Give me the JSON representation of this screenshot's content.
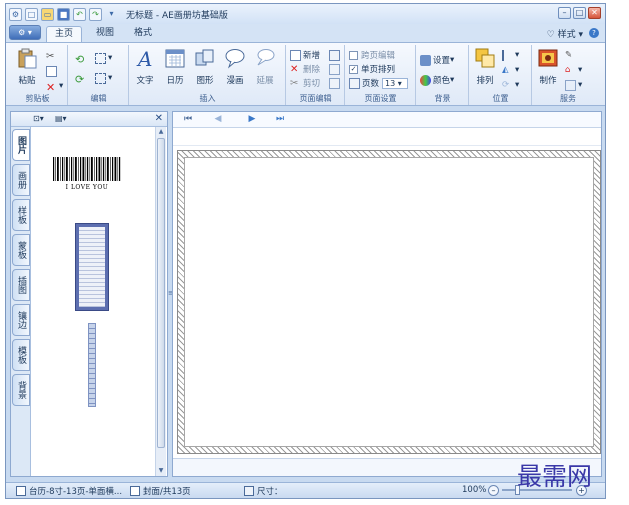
{
  "window": {
    "title": "无标题 - AE画册坊基础版",
    "controls": [
      "minimize",
      "maximize",
      "close"
    ]
  },
  "quick_access": [
    "app-icon",
    "new-icon",
    "open-icon",
    "save-icon",
    "undo-icon",
    "redo-icon",
    "dropdown-icon"
  ],
  "tabs": [
    {
      "label": "主页",
      "active": true
    },
    {
      "label": "视图",
      "active": false
    },
    {
      "label": "格式",
      "active": false
    }
  ],
  "style_menu": "样式",
  "ribbon": {
    "groups": {
      "clipboard": {
        "label": "剪贴板",
        "paste": "粘贴"
      },
      "edit": {
        "label": "编辑"
      },
      "insert": {
        "label": "插入",
        "items": [
          "文字",
          "日历",
          "图形",
          "漫画",
          "延展"
        ]
      },
      "page_edit": {
        "label": "页面编辑",
        "new": "新增",
        "delete": "删除",
        "cut": "剪切"
      },
      "page_setup": {
        "label": "页面设置",
        "cross_page": "跨页编辑",
        "single_page": "单页排列",
        "pages_label": "页数",
        "pages_value": "13"
      },
      "background": {
        "label": "背景",
        "settings": "设置",
        "color": "颜色"
      },
      "position": {
        "label": "位置",
        "arrange": "排列"
      },
      "service": {
        "label": "服务",
        "make": "制作"
      }
    }
  },
  "left_panel": {
    "vtabs": [
      "图片",
      "画册",
      "样板",
      "蒙板",
      "插图",
      "镶边",
      "模板",
      "背景"
    ],
    "barcode_text": "I LOVE YOU"
  },
  "status": {
    "template": "台历-8寸-13页-单面横...",
    "page": "封面/共13页",
    "size_label": "尺寸：",
    "zoom": "100%",
    "zoom_fraction": 0.2
  },
  "watermark": "最需网",
  "colors": {
    "accent": "#3a78c8",
    "watermark": "#3a38a8"
  }
}
